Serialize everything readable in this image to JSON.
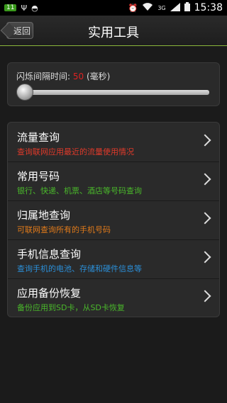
{
  "status": {
    "time": "15:38",
    "network": "3G",
    "badge": "11"
  },
  "header": {
    "back_label": "返回",
    "title": "实用工具"
  },
  "interval": {
    "label": "闪烁间隔时间: ",
    "value": "50",
    "unit": " (毫秒)",
    "slider_level": 0
  },
  "menu": {
    "items": [
      {
        "title": "流量查询",
        "subtitle": "查询联网应用最近的流量使用情况",
        "color": "#e03a2a"
      },
      {
        "title": "常用号码",
        "subtitle": "银行、快递、机票、酒店等号码查询",
        "color": "#4ab82b"
      },
      {
        "title": "归属地查询",
        "subtitle": "可联网查询所有的手机号码",
        "color": "#e07a1a"
      },
      {
        "title": "手机信息查询",
        "subtitle": "查询手机的电池、存储和硬件信息等",
        "color": "#2b8fd8"
      },
      {
        "title": "应用备份恢复",
        "subtitle": "备份应用到SD卡，从SD卡恢复",
        "color": "#4ab82b"
      }
    ]
  }
}
